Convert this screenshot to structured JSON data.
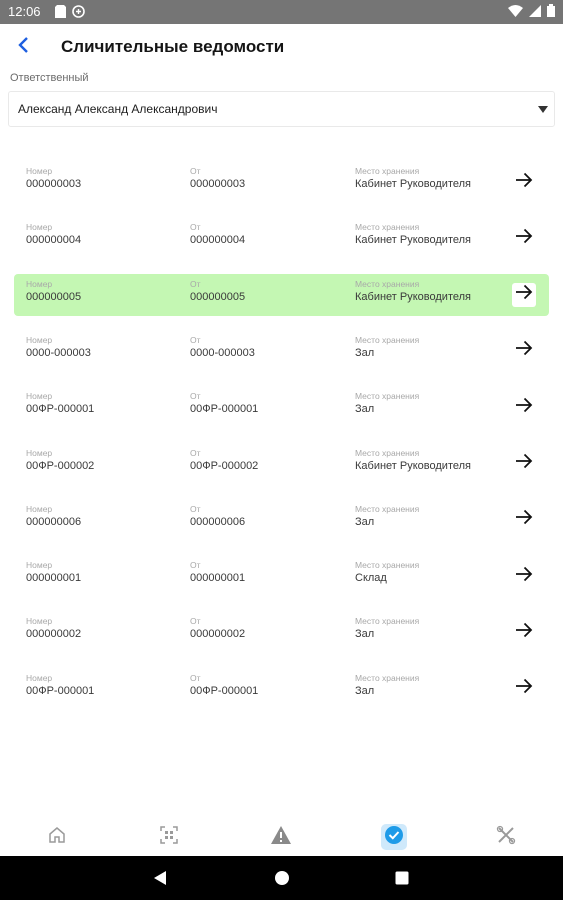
{
  "status_bar": {
    "time": "12:06",
    "icons": [
      "sd-card-icon",
      "sync-icon",
      "wifi-icon",
      "signal-icon",
      "battery-icon"
    ]
  },
  "header": {
    "title": "Сличительные ведомости",
    "back_icon": "chevron-left-icon",
    "accent_color": "#1e5fe0"
  },
  "responsible": {
    "label": "Ответственный",
    "value": "Александ Александ Александрович"
  },
  "columns": {
    "number": "Номер",
    "from": "От",
    "location": "Место хранения"
  },
  "documents": [
    {
      "number": "000000003",
      "from": "000000003",
      "location": "Кабинет Руководителя",
      "selected": false
    },
    {
      "number": "000000004",
      "from": "000000004",
      "location": "Кабинет Руководителя",
      "selected": false
    },
    {
      "number": "000000005",
      "from": "000000005",
      "location": "Кабинет Руководителя",
      "selected": true
    },
    {
      "number": "0000-000003",
      "from": "0000-000003",
      "location": "Зал",
      "selected": false
    },
    {
      "number": "00ФР-000001",
      "from": "00ФР-000001",
      "location": "Зал",
      "selected": false
    },
    {
      "number": "00ФР-000002",
      "from": "00ФР-000002",
      "location": "Кабинет Руководителя",
      "selected": false
    },
    {
      "number": "000000006",
      "from": "000000006",
      "location": "Зал",
      "selected": false
    },
    {
      "number": "000000001",
      "from": "000000001",
      "location": "Склад",
      "selected": false
    },
    {
      "number": "000000002",
      "from": "000000002",
      "location": "Зал",
      "selected": false
    },
    {
      "number": "00ФР-000001",
      "from": "00ФР-000001",
      "location": "Зал",
      "selected": false
    }
  ],
  "selected_row_color": "#c4f7b3",
  "bottom_nav": [
    {
      "icon": "home-icon",
      "active": false
    },
    {
      "icon": "qr-scan-icon",
      "active": false
    },
    {
      "icon": "warning-icon",
      "active": false
    },
    {
      "icon": "check-circle-icon",
      "active": true
    },
    {
      "icon": "tools-icon",
      "active": false
    }
  ],
  "system_nav": [
    "back-triangle-icon",
    "home-circle-icon",
    "recents-square-icon"
  ]
}
